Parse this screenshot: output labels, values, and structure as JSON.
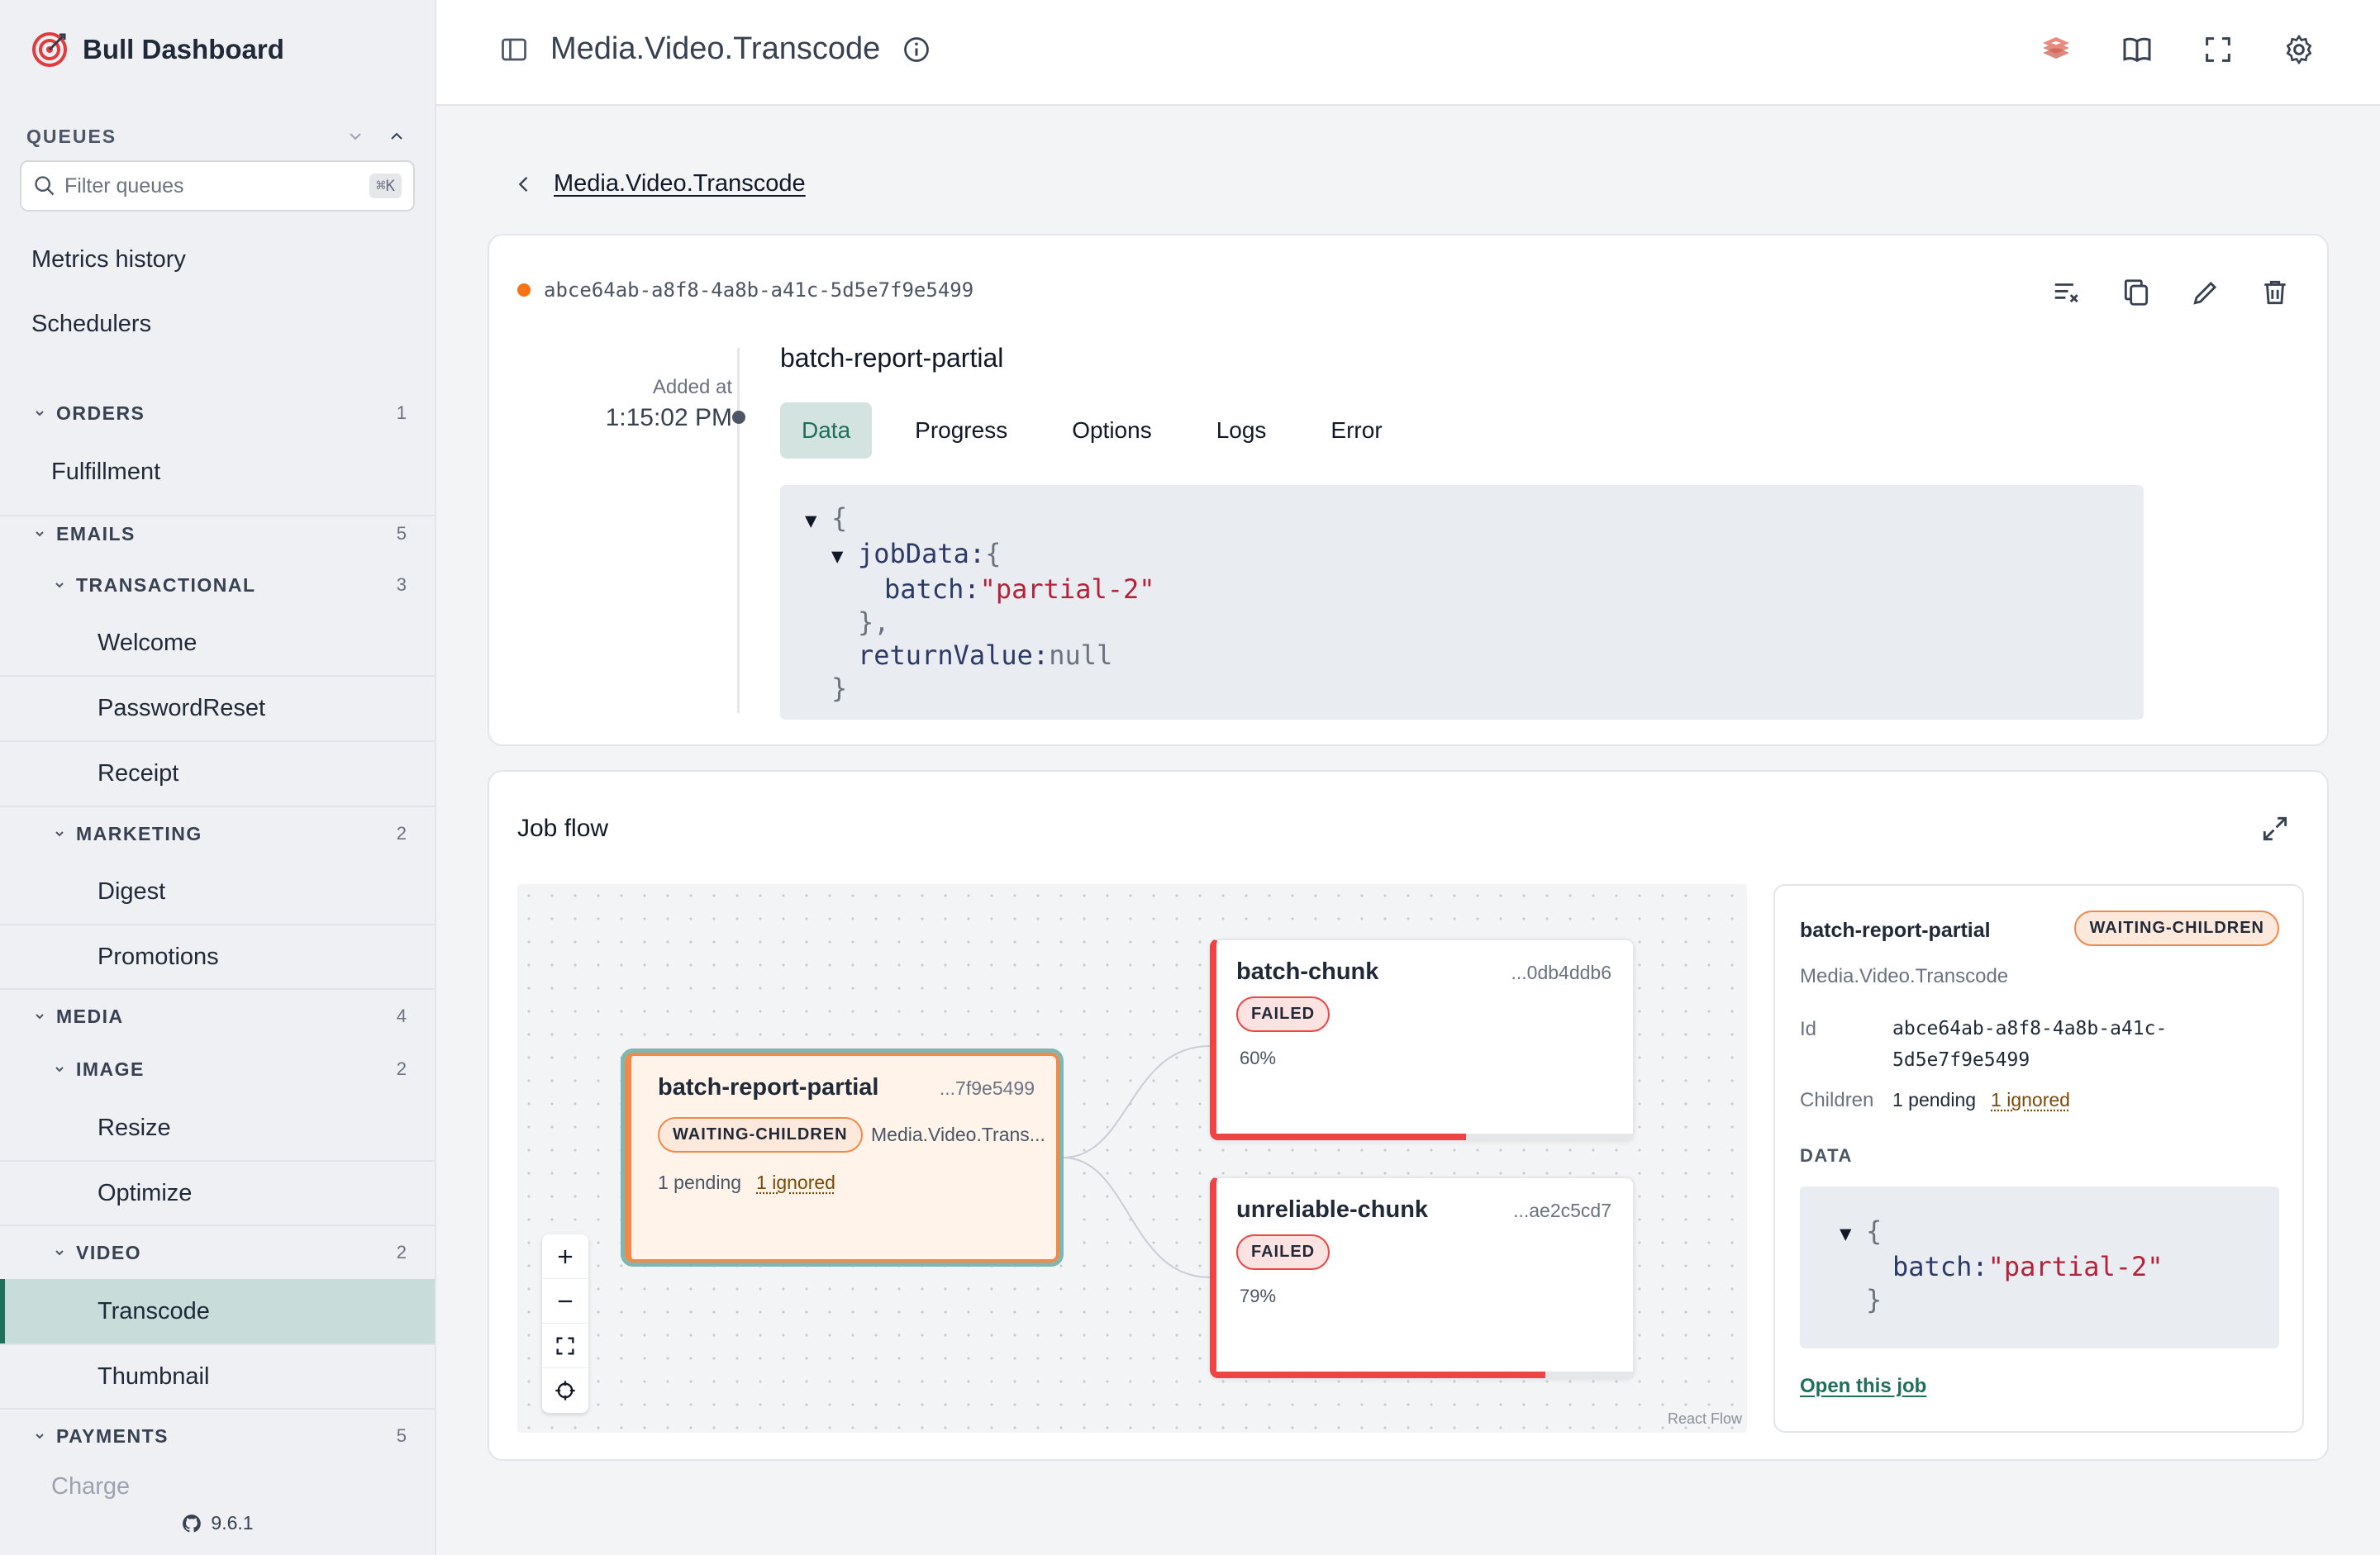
{
  "sidebar": {
    "brand": "Bull Dashboard",
    "queues_label": "QUEUES",
    "filter_placeholder": "Filter queues",
    "filter_shortcut": "⌘K",
    "links": [
      "Metrics history",
      "Schedulers"
    ],
    "groups": [
      {
        "name": "ORDERS",
        "count": "1"
      },
      {
        "name": "EMAILS",
        "count": "5"
      },
      {
        "name": "TRANSACTIONAL",
        "count": "3"
      },
      {
        "name": "MARKETING",
        "count": "2"
      },
      {
        "name": "MEDIA",
        "count": "4"
      },
      {
        "name": "IMAGE",
        "count": "2"
      },
      {
        "name": "VIDEO",
        "count": "2"
      },
      {
        "name": "PAYMENTS",
        "count": "5"
      }
    ],
    "items": [
      "Fulfillment",
      "Welcome",
      "PasswordReset",
      "Receipt",
      "Digest",
      "Promotions",
      "Resize",
      "Optimize",
      "Transcode",
      "Thumbnail",
      "Charge"
    ],
    "active_item": "Transcode",
    "version": "9.6.1"
  },
  "topbar": {
    "title": "Media.Video.Transcode"
  },
  "breadcrumb": {
    "back_label": "Media.Video.Transcode"
  },
  "job": {
    "id": "abce64ab-a8f8-4a8b-a41c-5d5e7f9e5499",
    "status_color": "#f97316",
    "added_label": "Added at",
    "added_time": "1:15:02 PM",
    "name": "batch-report-partial",
    "tabs": [
      "Data",
      "Progress",
      "Options",
      "Logs",
      "Error"
    ],
    "active_tab": "Data",
    "data": {
      "open_brace": "{",
      "jobData_key": "jobData:",
      "batch_key": "batch:",
      "batch_value": "\"partial-2\"",
      "close_inner": "},",
      "returnValue_key": "returnValue:",
      "returnValue_value": "null",
      "close_brace": "}"
    }
  },
  "flow": {
    "title": "Job flow",
    "attribution": "React Flow",
    "parent": {
      "name": "batch-report-partial",
      "short_id": "...7f9e5499",
      "status": "WAITING-CHILDREN",
      "queue": "Media.Video.Trans...",
      "pending": "1 pending",
      "ignored": "1 ignored"
    },
    "children": [
      {
        "name": "batch-chunk",
        "short_id": "...0db4ddb6",
        "status": "FAILED",
        "progress_label": "60%",
        "progress": 0.6
      },
      {
        "name": "unreliable-chunk",
        "short_id": "...ae2c5cd7",
        "status": "FAILED",
        "progress_label": "79%",
        "progress": 0.79
      }
    ],
    "detail": {
      "name": "batch-report-partial",
      "status": "WAITING-CHILDREN",
      "queue": "Media.Video.Transcode",
      "id_label": "Id",
      "id_line1": "abce64ab-a8f8-4a8b-a41c-",
      "id_line2": "5d5e7f9e5499",
      "children_label": "Children",
      "children_pending": "1 pending",
      "children_ignored": "1 ignored",
      "data_label": "DATA",
      "data_open": "{",
      "data_key": "batch:",
      "data_value": "\"partial-2\"",
      "data_close": "}",
      "open_link": "Open this job"
    }
  },
  "colors": {
    "accent": "#1f6f5c",
    "failed": "#ef4444",
    "waiting": "#f08a4b"
  }
}
